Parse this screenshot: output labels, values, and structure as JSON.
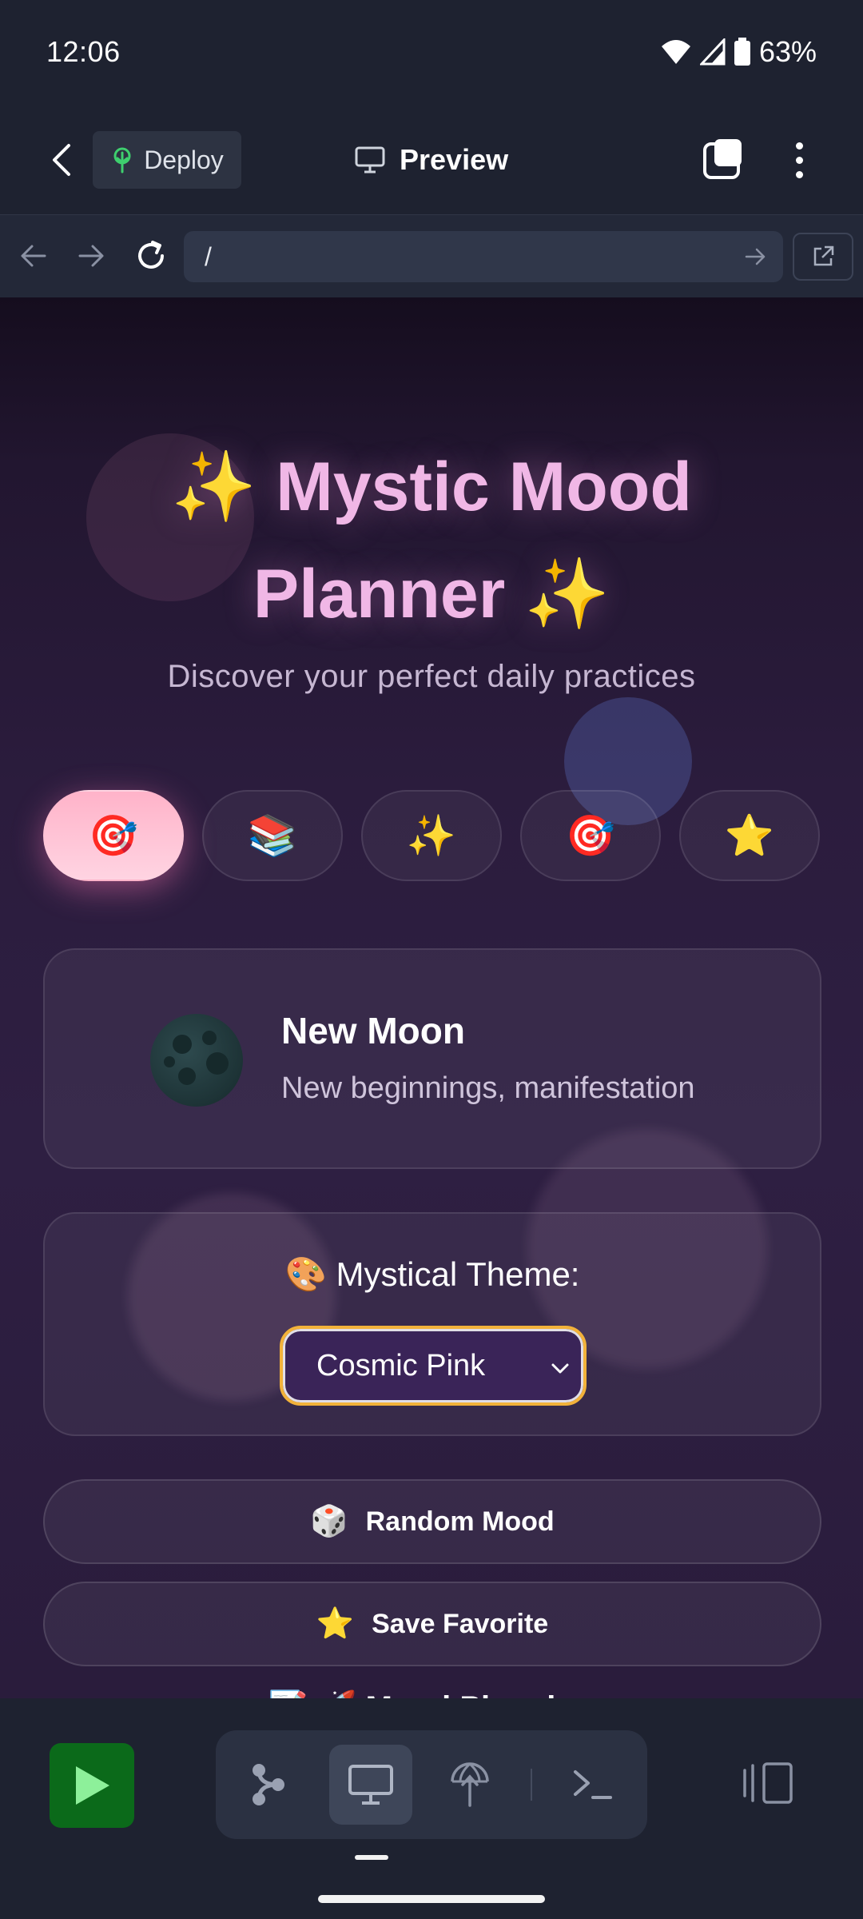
{
  "status": {
    "time": "12:06",
    "battery": "63%"
  },
  "header": {
    "deploy_label": "Deploy",
    "title": "Preview"
  },
  "browser": {
    "url": "/"
  },
  "app": {
    "title": "✨ Mystic Mood Planner ✨",
    "subtitle": "Discover your perfect daily practices",
    "tabs": [
      {
        "icon": "🎯",
        "name": "target"
      },
      {
        "icon": "📚",
        "name": "books"
      },
      {
        "icon": "✨",
        "name": "sparkles"
      },
      {
        "icon": "🎯",
        "name": "target"
      },
      {
        "icon": "⭐",
        "name": "star"
      }
    ],
    "moon": {
      "name": "New Moon",
      "description": "New beginnings, manifestation"
    },
    "theme": {
      "label": "🎨 Mystical Theme:",
      "selected": "Cosmic Pink"
    },
    "random_button": {
      "icon": "🎲",
      "label": "Random Mood"
    },
    "save_button": {
      "icon": "⭐",
      "label": "Save Favorite"
    },
    "next_section": "📝 🚀 Mood Planning"
  },
  "colors": {
    "accent_pink": "#f0b7e6",
    "select_border": "#f2b23a",
    "run_green": "#0b6a1a"
  }
}
